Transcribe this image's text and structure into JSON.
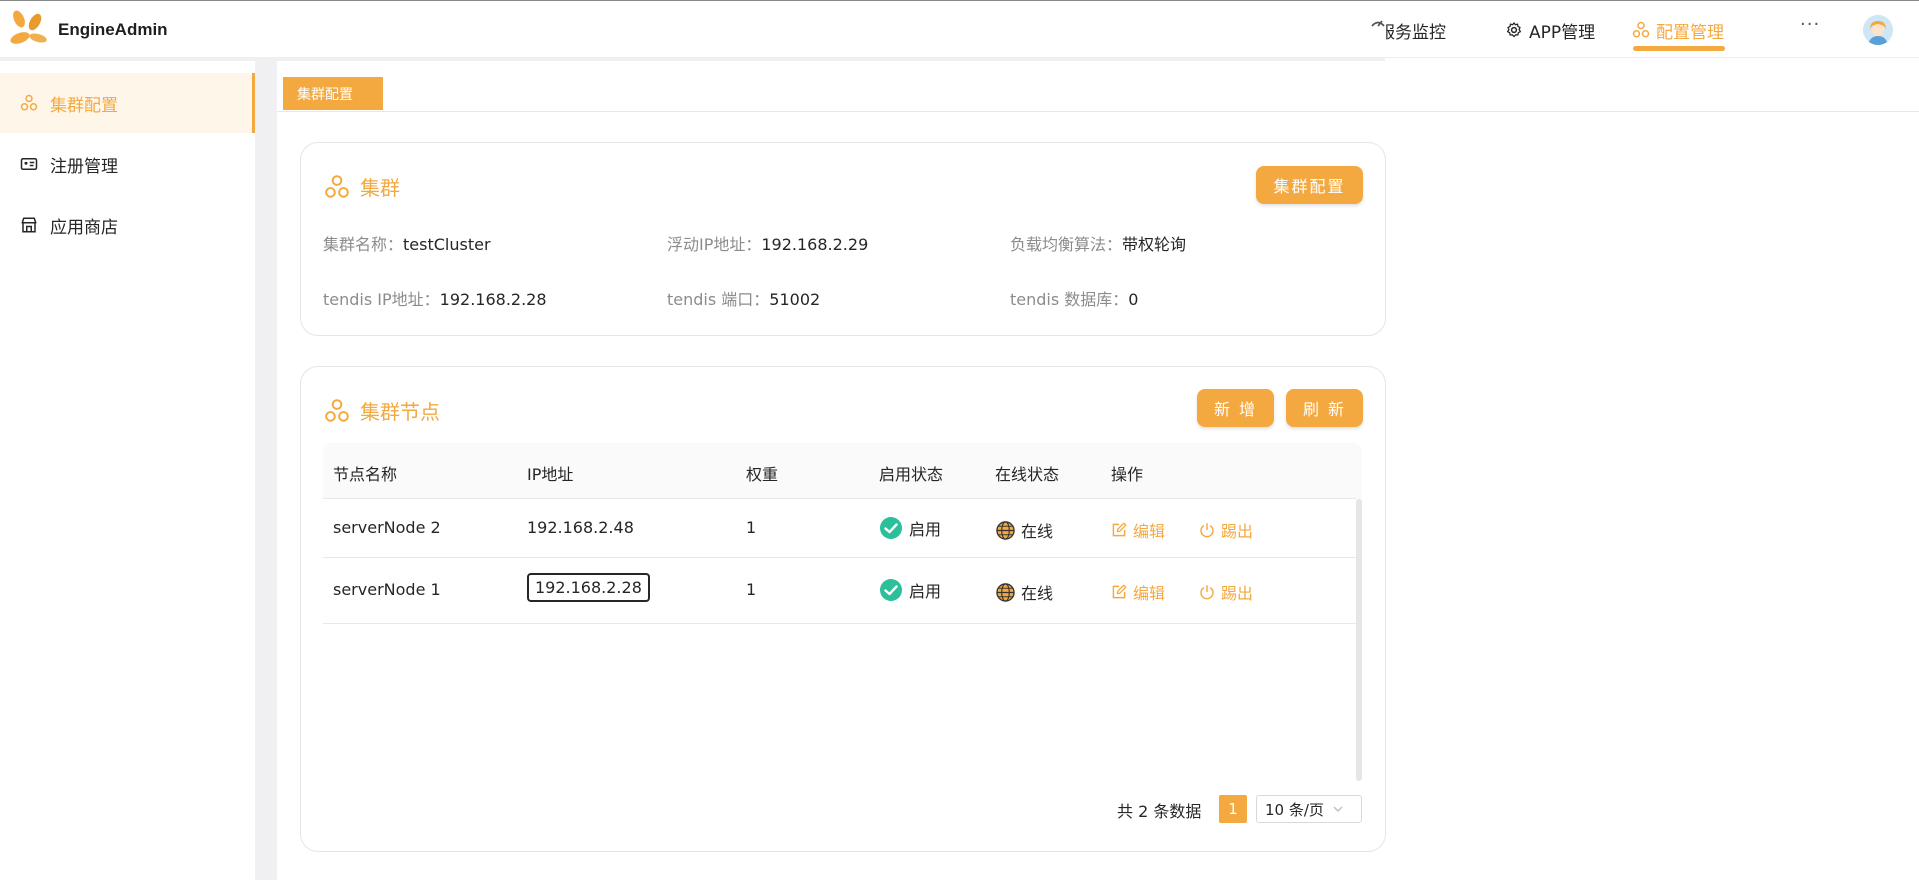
{
  "app": {
    "title": "EngineAdmin"
  },
  "topnav": {
    "items": [
      {
        "label": "服务监控",
        "icon": "monitor-icon"
      },
      {
        "label": "APP管理",
        "icon": "gear-icon"
      },
      {
        "label": "配置管理",
        "icon": "cluster-icon",
        "active": true
      }
    ],
    "more_label": "···"
  },
  "sidebar": {
    "items": [
      {
        "label": "集群配置",
        "icon": "cluster-icon",
        "active": true
      },
      {
        "label": "注册管理",
        "icon": "id-card-icon"
      },
      {
        "label": "应用商店",
        "icon": "store-icon"
      }
    ]
  },
  "tabs": [
    {
      "label": "集群配置",
      "active": true
    }
  ],
  "cluster_card": {
    "title": "集群",
    "button_label": "集群配置",
    "fields": [
      {
        "label": "集群名称：",
        "value": "testCluster"
      },
      {
        "label": "浮动IP地址：",
        "value": "192.168.2.29"
      },
      {
        "label": "负载均衡算法：",
        "value": "带权轮询"
      },
      {
        "label": "tendis IP地址：",
        "value": "192.168.2.28"
      },
      {
        "label": "tendis 端口：",
        "value": "51002"
      },
      {
        "label": "tendis 数据库：",
        "value": "0"
      }
    ]
  },
  "nodes_card": {
    "title": "集群节点",
    "add_label": "新 增",
    "refresh_label": "刷 新",
    "columns": [
      "节点名称",
      "IP地址",
      "权重",
      "启用状态",
      "在线状态",
      "操作"
    ],
    "rows": [
      {
        "name": "serverNode 2",
        "ip": "192.168.2.48",
        "weight": "1",
        "enabled": "启用",
        "online": "在线",
        "edit": "编辑",
        "kick": "踢出"
      },
      {
        "name": "serverNode 1",
        "ip": "192.168.2.28",
        "weight": "1",
        "enabled": "启用",
        "online": "在线",
        "edit": "编辑",
        "kick": "踢出"
      }
    ],
    "pagination": {
      "total_text": "共 2 条数据",
      "current_page": "1",
      "page_size": "10 条/页"
    }
  },
  "colors": {
    "accent": "#f4a940",
    "success": "#2bbf9a",
    "text": "#262626",
    "muted": "#8c8c8c"
  }
}
